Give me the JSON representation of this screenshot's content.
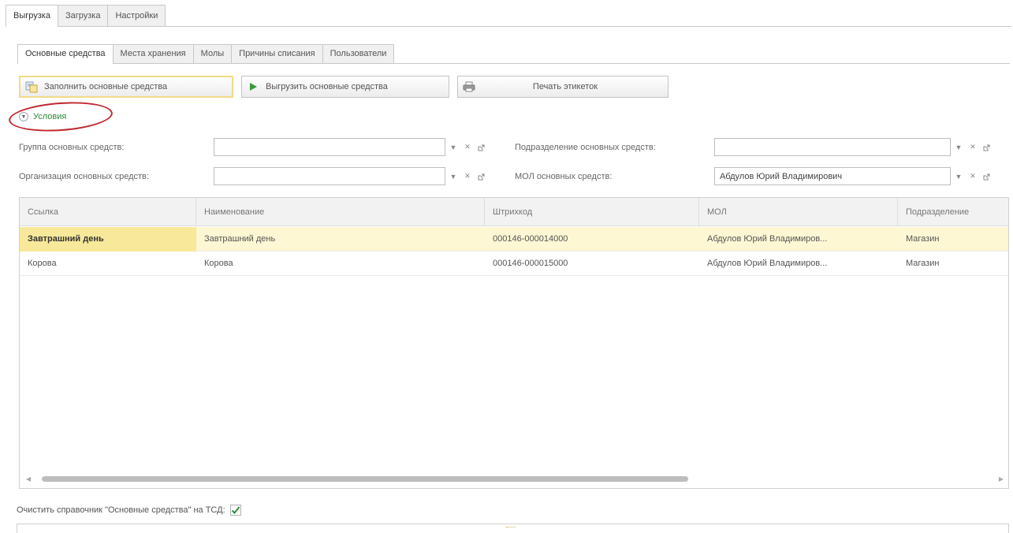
{
  "top_tabs": [
    {
      "label": "Выгрузка",
      "active": true
    },
    {
      "label": "Загрузка",
      "active": false
    },
    {
      "label": "Настройки",
      "active": false
    }
  ],
  "sub_tabs": [
    {
      "label": "Основные средства",
      "active": true
    },
    {
      "label": "Места хранения",
      "active": false
    },
    {
      "label": "Молы",
      "active": false
    },
    {
      "label": "Причины списания",
      "active": false
    },
    {
      "label": "Пользователи",
      "active": false
    }
  ],
  "toolbar": {
    "fill_label": "Заполнить основные средства",
    "export_label": "Выгрузить основные средства",
    "print_label": "Печать этикеток"
  },
  "conditions": {
    "label": "Условия",
    "expanded": true
  },
  "filters": {
    "group": {
      "label": "Группа основных средств:",
      "value": ""
    },
    "subdivision": {
      "label": "Подразделение основных средств:",
      "value": ""
    },
    "organization": {
      "label": "Организация основных средств:",
      "value": ""
    },
    "mol": {
      "label": "МОЛ основных средств:",
      "value": "Абдулов Юрий Владимирович"
    }
  },
  "table": {
    "columns": [
      "Ссылка",
      "Наименование",
      "Штрихкод",
      "МОЛ",
      "Подразделение"
    ],
    "rows": [
      {
        "ref": "Завтрашний день",
        "name": "Завтрашний день",
        "barcode": "000146-000014000",
        "mol": "Абдулов Юрий Владимиров...",
        "subdivision": "Магазин",
        "selected": true
      },
      {
        "ref": "Корова",
        "name": "Корова",
        "barcode": "000146-000015000",
        "mol": "Абдулов Юрий Владимиров...",
        "subdivision": "Магазин",
        "selected": false
      }
    ]
  },
  "clear_directory": {
    "label": "Очистить справочник \"Основные средства\" на ТСД:",
    "checked": true
  },
  "colors": {
    "accent_green": "#2e8b3a",
    "highlight_ring": "#c0282f",
    "selected_row": "#fdf7d3",
    "selected_cell": "#f8e99a",
    "button_focus": "#f1dc88"
  }
}
